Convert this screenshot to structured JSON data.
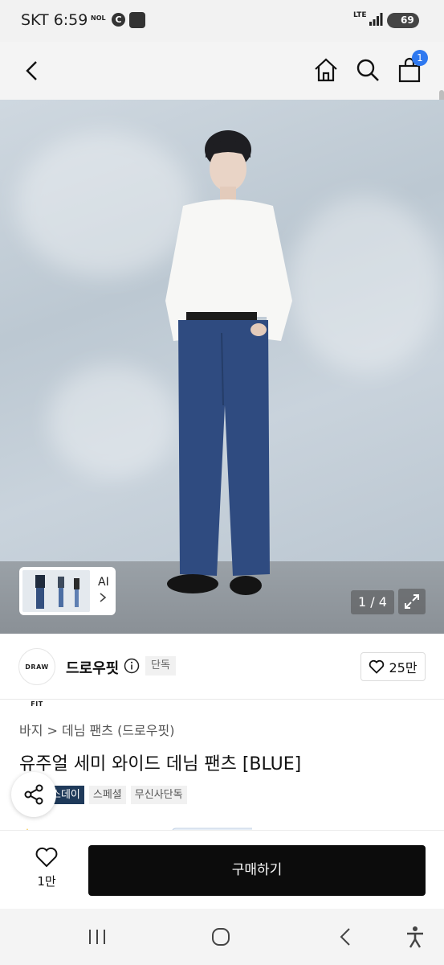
{
  "status_bar": {
    "time": "SKT 6:59",
    "nol_label": "NOL",
    "c_label": "C",
    "network": "LTE",
    "battery": "69"
  },
  "header": {
    "cart_count": "1"
  },
  "gallery": {
    "ai_label": "AI",
    "counter": "1 / 4"
  },
  "brand": {
    "logo_text": "DRAW FIT",
    "name": "드로우핏",
    "exclusive_tag": "단독",
    "like_count": "25만"
  },
  "product": {
    "breadcrumb": "바지 > 데님 팬츠 (드로우핏)",
    "title": "유주얼 세미 와이드 데님 팬츠 [BLUE]",
    "tags": [
      "스데이",
      "스페셜",
      "무신사단독"
    ]
  },
  "action_bar": {
    "wish_count": "1만",
    "buy_label": "구매하기"
  },
  "colors": {
    "accent_blue": "#2f79f0",
    "buy_button": "#0c0c0c",
    "tag_dark": "#1f3a5a"
  }
}
